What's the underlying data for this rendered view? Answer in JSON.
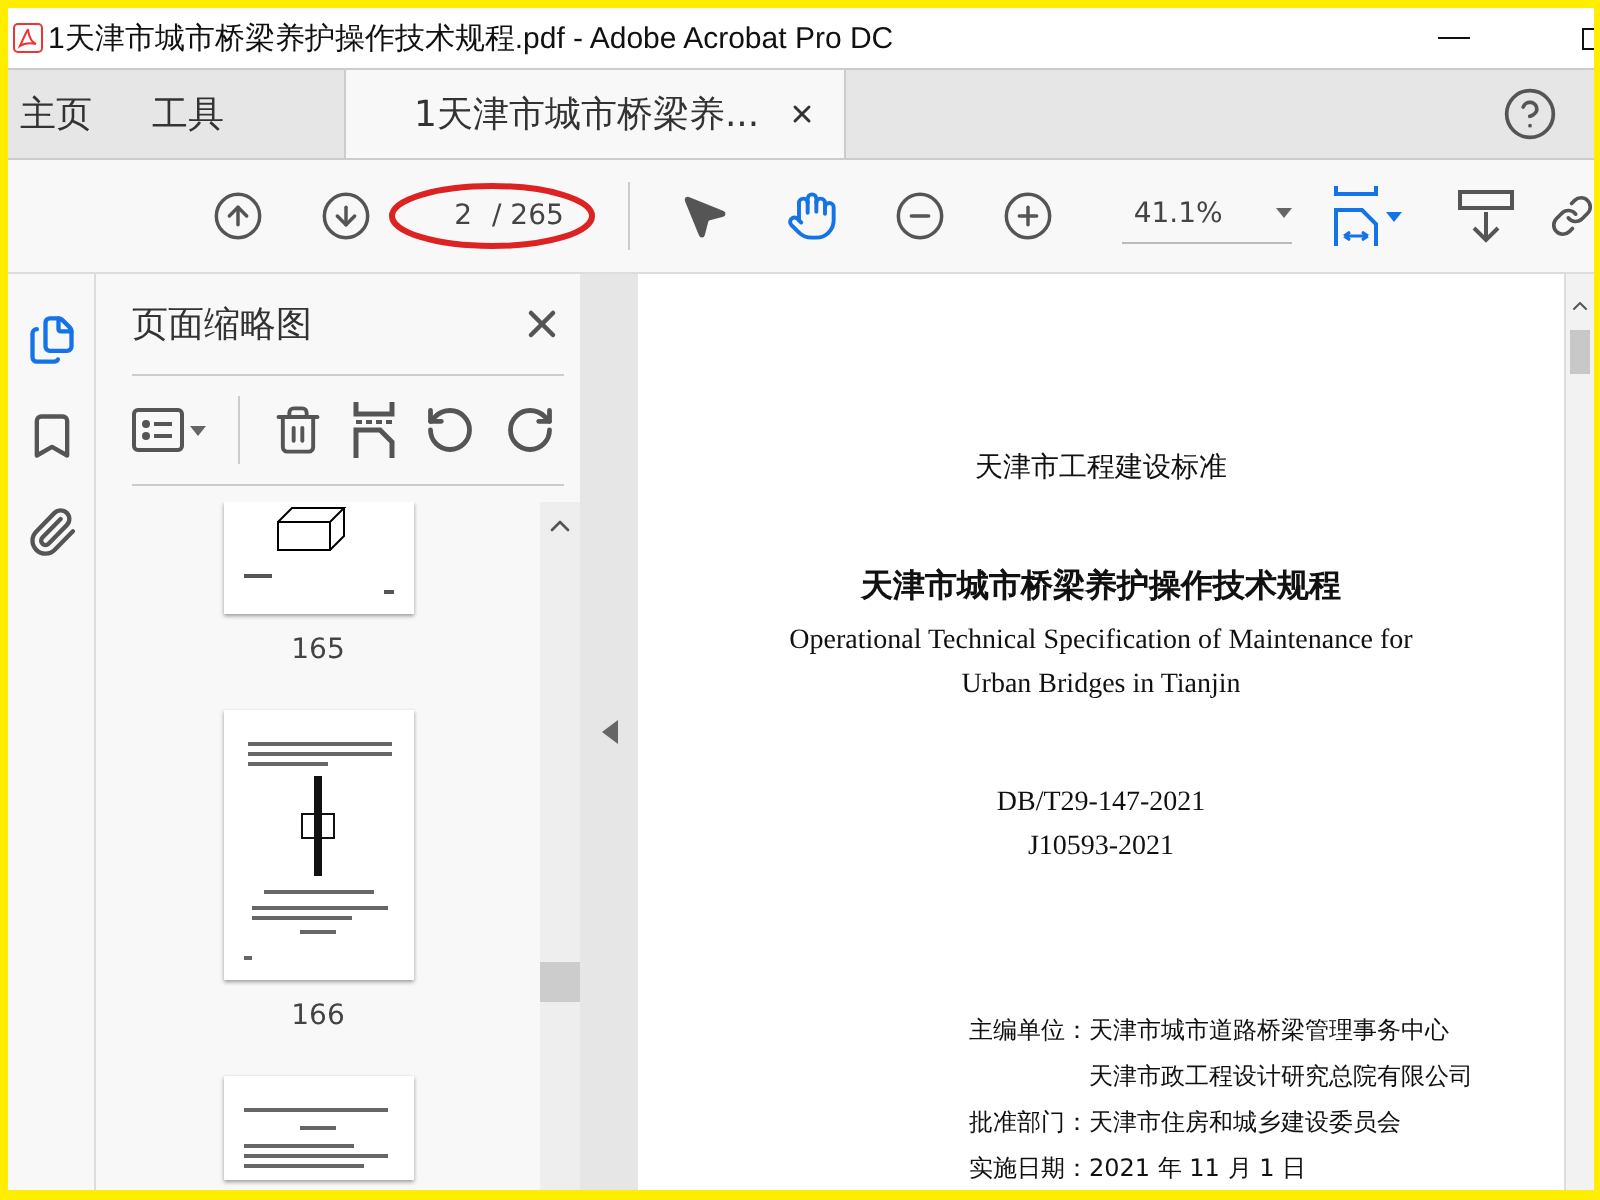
{
  "window": {
    "title": "1天津市城市桥梁养护操作技术规程.pdf - Adobe Acrobat Pro DC"
  },
  "tabs": [
    {
      "label": "主页",
      "selected": false,
      "closable": false
    },
    {
      "label": "工具",
      "selected": false,
      "closable": false
    },
    {
      "label": "1天津市城市桥梁养...",
      "selected": true,
      "closable": true
    }
  ],
  "toolbar": {
    "current_page": "2",
    "page_total": "/ 265",
    "zoom": "41.1%",
    "tools": [
      {
        "kind": "select",
        "selected": false
      },
      {
        "kind": "hand",
        "selected": true
      }
    ]
  },
  "nav": [
    {
      "kind": "pages",
      "selected": true
    },
    {
      "kind": "bookmarks",
      "selected": false
    },
    {
      "kind": "attachments",
      "selected": false
    }
  ],
  "sidebar": {
    "title": "页面缩略图",
    "thumbnails": [
      {
        "label": "165",
        "kind": "box"
      },
      {
        "label": "166",
        "kind": "post"
      },
      {
        "kind": "text"
      }
    ]
  },
  "document": {
    "heading": "天津市工程建设标准",
    "title": "天津市城市桥梁养护操作技术规程",
    "english": [
      "Operational Technical Specification of Maintenance for",
      "Urban Bridges in Tianjin"
    ],
    "codes": [
      "DB/T29-147-2021",
      "J10593-2021"
    ],
    "info": [
      {
        "label": "主编单位：",
        "values": [
          "天津市城市道路桥梁管理事务中心",
          "天津市政工程设计研究总院有限公司"
        ]
      },
      {
        "label": "批准部门：",
        "values": [
          "天津市住房和城乡建设委员会"
        ]
      },
      {
        "label": "实施日期：",
        "values": [
          "2021 年 11 月 1 日"
        ]
      }
    ]
  }
}
